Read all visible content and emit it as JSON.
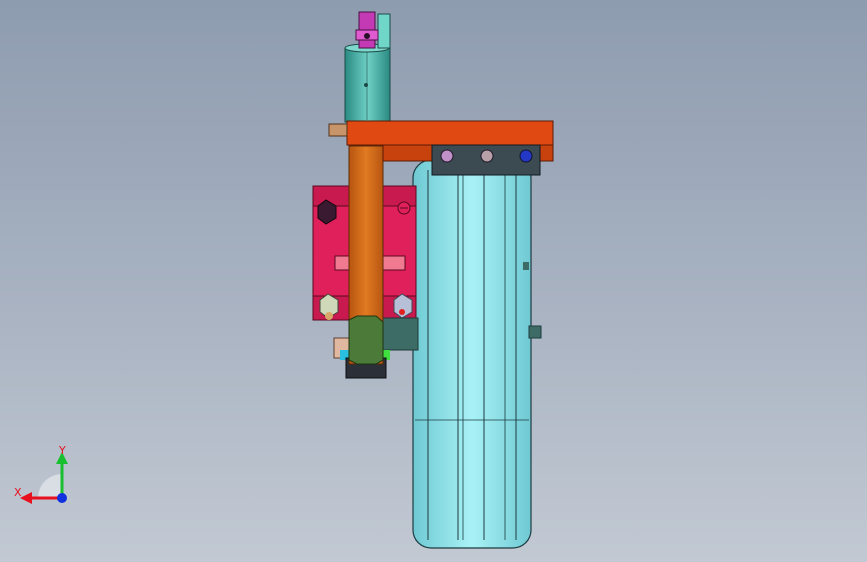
{
  "view": {
    "colors": {
      "background_top": "#8e9cb0",
      "background_bottom": "#c2c9d3",
      "bracket_orange": "#e04a12",
      "arm_orange": "#d66a1a",
      "block_magenta": "#e0205a",
      "wheel_cyan": "#8fe6ee",
      "post_teal": "#3aa8a0",
      "plate_dark": "#3c4a52",
      "clip_purple": "#c43ab4"
    }
  },
  "triad": {
    "x_label": "X",
    "y_label": "Y",
    "x_color": "#e8101e",
    "y_color": "#18c030",
    "z_color": "#1030e0"
  }
}
